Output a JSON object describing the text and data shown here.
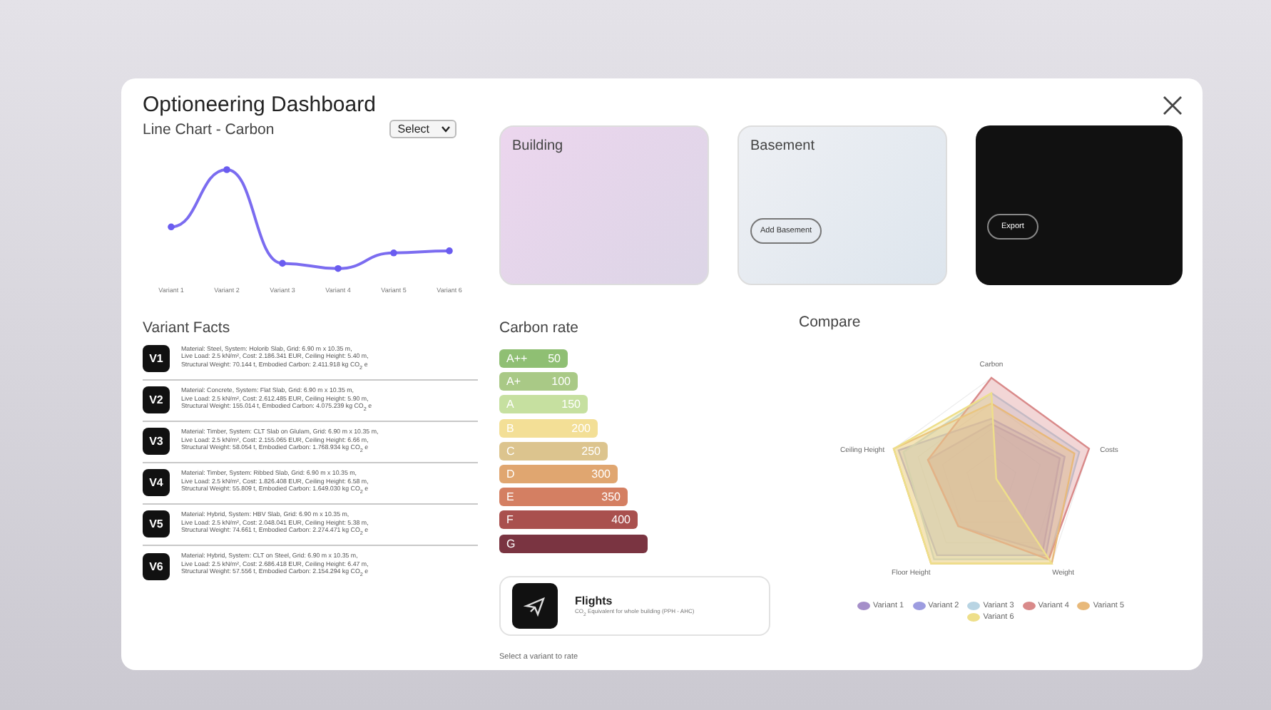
{
  "window": {
    "title": "Optioneering Dashboard"
  },
  "line_chart": {
    "title": "Line Chart - Carbon",
    "select": {
      "value": "Select"
    },
    "x_labels": [
      "Variant 1",
      "Variant 2",
      "Variant 3",
      "Variant 4",
      "Variant 5",
      "Variant 6"
    ]
  },
  "cards": [
    {
      "kind": "building",
      "title": "Building"
    },
    {
      "kind": "basement",
      "title": "Basement",
      "button": "Add Basement"
    },
    {
      "kind": "export",
      "button": "Export"
    }
  ],
  "variant_facts": {
    "title": "Variant Facts",
    "items": [
      {
        "badge": "V1",
        "lines": [
          "Material: Steel, System: Holorib Slab, Grid: 6.90 m x 10.35 m,",
          "Live Load: 2.5 kN/m², Cost: 2.186.341 EUR, Ceiling Height: 5.40 m,",
          "Structural Weight: 70.144 t, Embodied Carbon: 2.411.918 kg CO$_{2}$ e"
        ]
      },
      {
        "badge": "V2",
        "lines": [
          "Material: Concrete, System: Flat Slab, Grid: 6.90 m x 10.35 m,",
          "Live Load: 2.5 kN/m², Cost: 2.612.485 EUR, Ceiling Height: 5.90 m,",
          "Structural Weight: 155.014 t, Embodied Carbon: 4.075.239 kg CO$_{2}$ e"
        ]
      },
      {
        "badge": "V3",
        "lines": [
          "Material: Timber, System: CLT Slab on Glulam, Grid: 6.90 m x 10.35 m,",
          "Live Load: 2.5 kN/m², Cost: 2.155.065 EUR, Ceiling Height: 6.66 m,",
          "Structural Weight: 58.054 t, Embodied Carbon: 1.768.934 kg CO$_{2}$ e"
        ]
      },
      {
        "badge": "V4",
        "lines": [
          "Material: Timber, System: Ribbed Slab, Grid: 6.90 m x 10.35 m,",
          "Live Load: 2.5 kN/m², Cost: 1.826.408 EUR, Ceiling Height: 6.58 m,",
          "Structural Weight: 55.809 t, Embodied Carbon: 1.649.030 kg CO$_{2}$ e"
        ]
      },
      {
        "badge": "V5",
        "lines": [
          "Material: Hybrid, System: HBV Slab, Grid: 6.90 m x 10.35 m,",
          "Live Load: 2.5 kN/m², Cost: 2.048.041 EUR, Ceiling Height: 5.38 m,",
          "Structural Weight: 74.661 t, Embodied Carbon: 2.274.471 kg CO$_{2}$ e"
        ]
      },
      {
        "badge": "V6",
        "lines": [
          "Material: Hybrid, System: CLT on Steel, Grid: 6.90 m x 10.35 m,",
          "Live Load: 2.5 kN/m², Cost: 2.686.418 EUR, Ceiling Height: 6.47 m,",
          "Structural Weight: 57.556 t, Embodied Carbon: 2.154.294 kg CO$_{2}$ e"
        ]
      }
    ]
  },
  "carbon_rate": {
    "title": "Carbon rate",
    "bands": [
      {
        "label": "A++",
        "value": "50",
        "color": "#8fbf73"
      },
      {
        "label": "A+",
        "value": "100",
        "color": "#a9c986"
      },
      {
        "label": "A",
        "value": "150",
        "color": "#c6e0a0"
      },
      {
        "label": "B",
        "value": "200",
        "color": "#f3df96"
      },
      {
        "label": "C",
        "value": "250",
        "color": "#dcc48e"
      },
      {
        "label": "D",
        "value": "300",
        "color": "#e0a670"
      },
      {
        "label": "E",
        "value": "350",
        "color": "#d47f62"
      },
      {
        "label": "F",
        "value": "400",
        "color": "#a9504e"
      },
      {
        "label": "G",
        "color": "#7a3441"
      }
    ],
    "flights": {
      "title": "Flights",
      "subtitle": "CO$_{2}$ Equivalent for whole building (PPH - AHC)"
    },
    "hint": "Select a variant to rate"
  },
  "compare": {
    "title": "Compare",
    "axes": [
      "Carbon",
      "Costs",
      "Weight",
      "Floor Height",
      "Ceiling Height"
    ],
    "legend": [
      {
        "label": "Variant 1",
        "color": "#a58fc9"
      },
      {
        "label": "Variant 2",
        "color": "#9d9ce0"
      },
      {
        "label": "Variant 3",
        "color": "#b8d4e3"
      },
      {
        "label": "Variant 4",
        "color": "#d98a8a"
      },
      {
        "label": "Variant 5",
        "color": "#e8b97a"
      },
      {
        "label": "Variant 6",
        "color": "#eedf8a"
      }
    ]
  }
}
